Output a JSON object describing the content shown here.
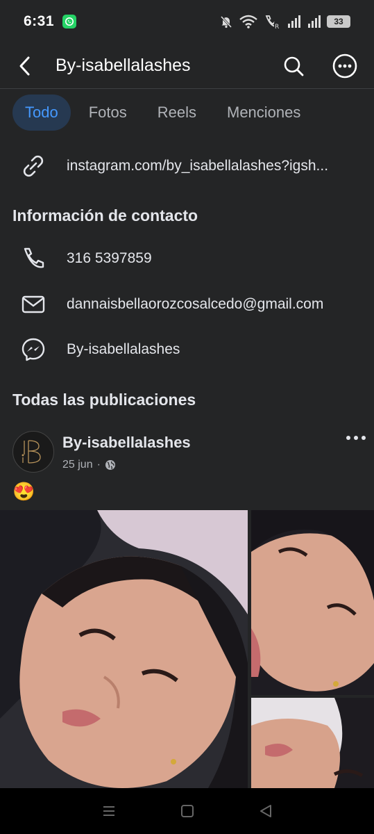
{
  "status_bar": {
    "time": "6:31",
    "battery": "33"
  },
  "header": {
    "title": "By-isabellalashes"
  },
  "tabs": [
    {
      "label": "Todo"
    },
    {
      "label": "Fotos"
    },
    {
      "label": "Reels"
    },
    {
      "label": "Menciones"
    }
  ],
  "link": {
    "text": "instagram.com/by_isabellalashes?igsh..."
  },
  "contact": {
    "title": "Información de contacto",
    "phone": "316 5397859",
    "email": "dannaisbellaorozcosalcedo@gmail.com",
    "messenger": "By-isabellalashes"
  },
  "posts_section": {
    "title": "Todas las publicaciones"
  },
  "post": {
    "author": "By-isabellalashes",
    "date": "25 jun",
    "separator": "·",
    "text": "😍"
  },
  "colors": {
    "background": "#242526",
    "accent": "#4599ff",
    "active_tab_bg": "#263951"
  }
}
